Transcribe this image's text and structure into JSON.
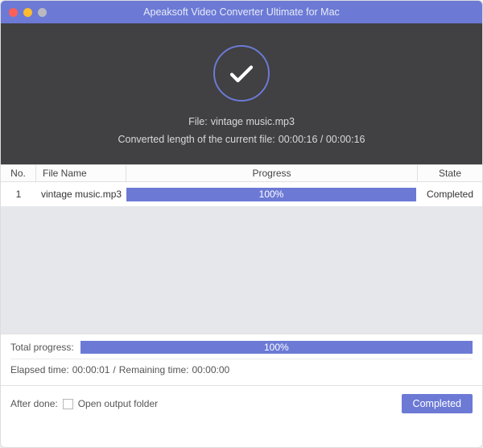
{
  "titlebar": {
    "title": "Apeaksoft Video Converter Ultimate for Mac"
  },
  "status": {
    "file_prefix": "File:",
    "file_name": "vintage music.mp3",
    "converted_prefix": "Converted length of the current file:",
    "converted_value": "00:00:16 / 00:00:16"
  },
  "table": {
    "headers": {
      "no": "No.",
      "file_name": "File Name",
      "progress": "Progress",
      "state": "State"
    },
    "rows": [
      {
        "no": "1",
        "file_name": "vintage music.mp3",
        "progress_text": "100%",
        "progress_pct": 100,
        "state": "Completed"
      }
    ]
  },
  "footer": {
    "total_label": "Total progress:",
    "total_progress_text": "100%",
    "total_progress_pct": 100,
    "elapsed_label": "Elapsed time:",
    "elapsed_value": "00:00:01",
    "separator": "/",
    "remaining_label": "Remaining time:",
    "remaining_value": "00:00:00",
    "after_done_label": "After done:",
    "open_folder_label": "Open output folder",
    "button_label": "Completed"
  },
  "colors": {
    "accent": "#6c7ad5"
  }
}
